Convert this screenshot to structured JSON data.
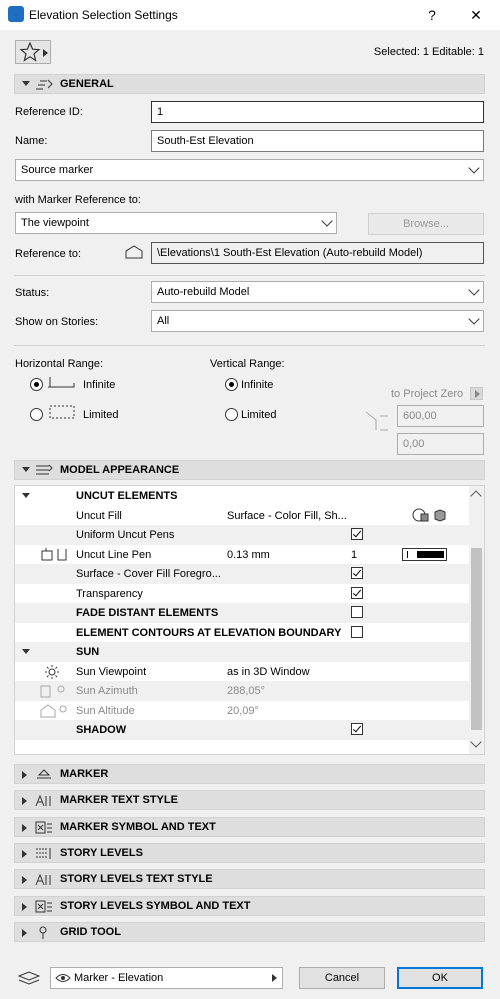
{
  "window": {
    "title": "Elevation Selection Settings",
    "help": "?",
    "close": "✕"
  },
  "header": {
    "selection_info": "Selected: 1 Editable: 1"
  },
  "general": {
    "section_label": "GENERAL",
    "reference_id_label": "Reference ID:",
    "reference_id_value": "1",
    "name_label": "Name:",
    "name_value": "South-Est Elevation",
    "source_marker": "Source marker",
    "marker_ref_label": "with Marker Reference to:",
    "marker_ref_value": "The viewpoint",
    "browse": "Browse...",
    "reference_to_label": "Reference to:",
    "reference_to_value": "\\Elevations\\1 South-Est Elevation (Auto-rebuild Model)",
    "status_label": "Status:",
    "status_value": "Auto-rebuild Model",
    "stories_label": "Show on Stories:",
    "stories_value": "All",
    "hrange_label": "Horizontal Range:",
    "vrange_label": "Vertical Range:",
    "infinite": "Infinite",
    "limited": "Limited",
    "project_zero": "to Project Zero",
    "v_top": "600,00",
    "v_bottom": "0,00",
    "h_selected": "Infinite",
    "v_selected": "Infinite"
  },
  "model_appearance": {
    "section_label": "MODEL APPEARANCE",
    "rows": [
      {
        "type": "group",
        "label": "UNCUT ELEMENTS"
      },
      {
        "label": "Uncut Fill",
        "value": "Surface - Color Fill, Sh..."
      },
      {
        "label": "Uniform Uncut Pens",
        "check": true
      },
      {
        "label": "Uncut Line Pen",
        "value": "0.13 mm",
        "pen": "1"
      },
      {
        "label": "Surface - Cover Fill Foregro...",
        "check": true
      },
      {
        "label": "Transparency",
        "check": true
      },
      {
        "type": "group",
        "label": "FADE DISTANT ELEMENTS",
        "check": false
      },
      {
        "type": "group",
        "label": "ELEMENT CONTOURS AT ELEVATION BOUNDARY",
        "check": false
      },
      {
        "type": "group",
        "label": "SUN"
      },
      {
        "label": "Sun Viewpoint",
        "value": "as in 3D Window"
      },
      {
        "label": "Sun Azimuth",
        "value": "288,05°",
        "disabled": true
      },
      {
        "label": "Sun Altitude",
        "value": "20,09°",
        "disabled": true
      },
      {
        "type": "group",
        "label": "SHADOW",
        "check": true
      }
    ]
  },
  "sections": [
    "MARKER",
    "MARKER TEXT STYLE",
    "MARKER SYMBOL AND TEXT",
    "STORY LEVELS",
    "STORY LEVELS TEXT STYLE",
    "STORY LEVELS SYMBOL AND TEXT",
    "GRID TOOL"
  ],
  "footer": {
    "layer": "Marker - Elevation",
    "cancel": "Cancel",
    "ok": "OK"
  }
}
